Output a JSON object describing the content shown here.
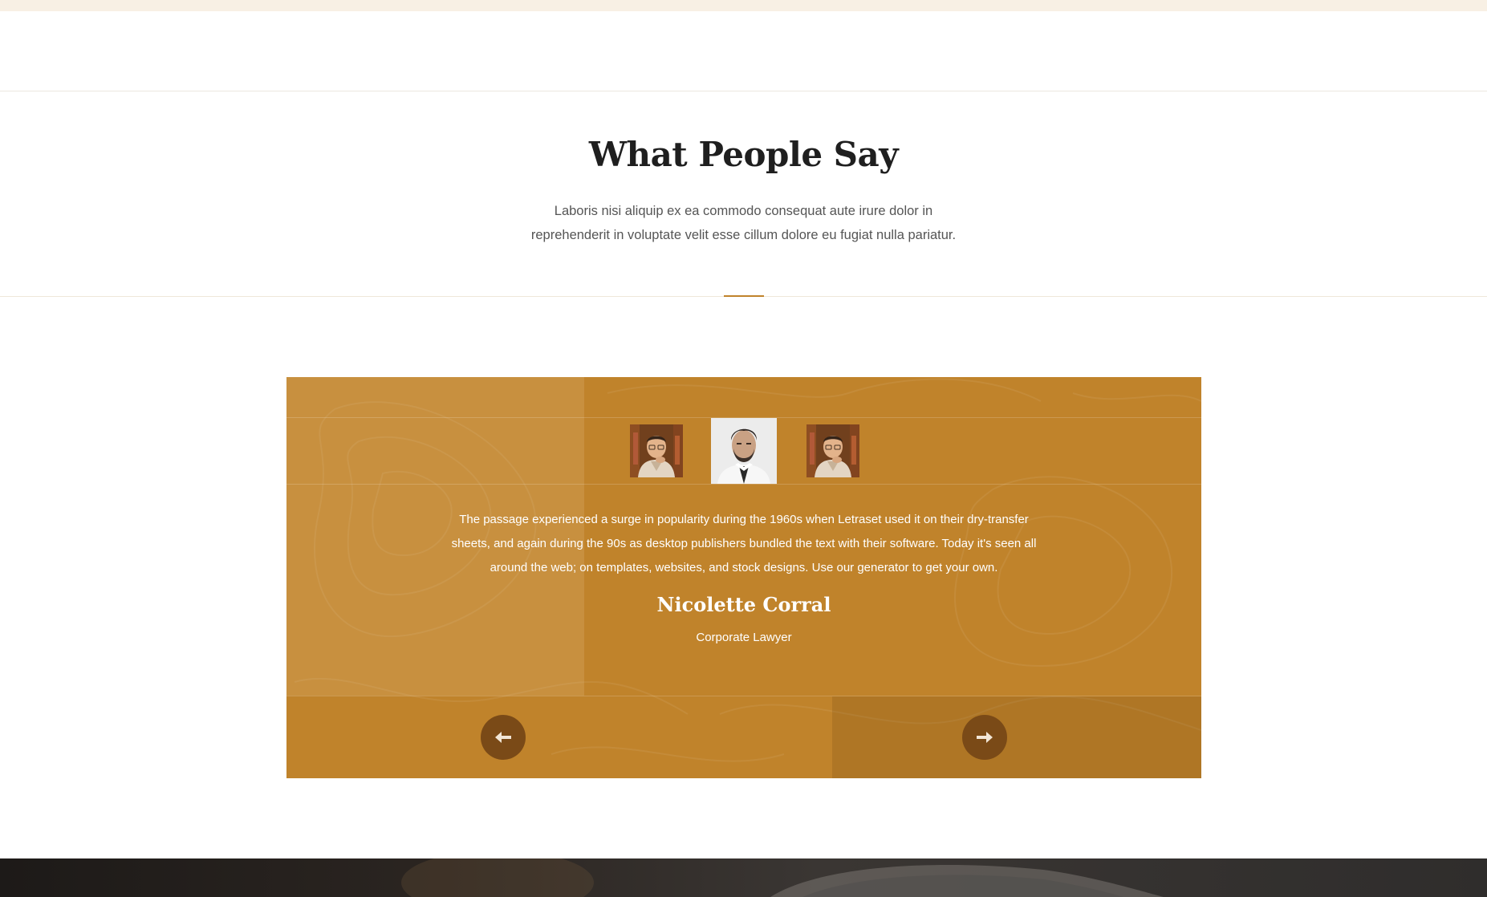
{
  "section": {
    "title": "What People Say",
    "subtitle_line1": "Laboris nisi aliquip ex ea commodo consequat aute irure dolor in",
    "subtitle_line2": "reprehenderit in voluptate velit esse cillum dolore eu fugiat nulla pariatur."
  },
  "colors": {
    "accent": "#c0832b",
    "button": "#7a4a17",
    "title": "#1f1f1f"
  },
  "testimonial": {
    "active_index": 1,
    "avatars": [
      {
        "icon": "man-with-glasses-portrait"
      },
      {
        "icon": "man-with-beard-portrait"
      },
      {
        "icon": "man-with-glasses-portrait"
      }
    ],
    "quote_line1": "The passage experienced a surge in popularity during the 1960s when Letraset used it on their dry-transfer",
    "quote_line2": "sheets, and again during the 90s as desktop publishers bundled the text with their software. Today it's seen all",
    "quote_line3": "around the web; on templates, websites, and stock designs. Use our generator to get your own.",
    "name": "Nicolette Corral",
    "role": "Corporate Lawyer"
  },
  "nav": {
    "prev_icon": "arrow-left-icon",
    "next_icon": "arrow-right-icon"
  }
}
